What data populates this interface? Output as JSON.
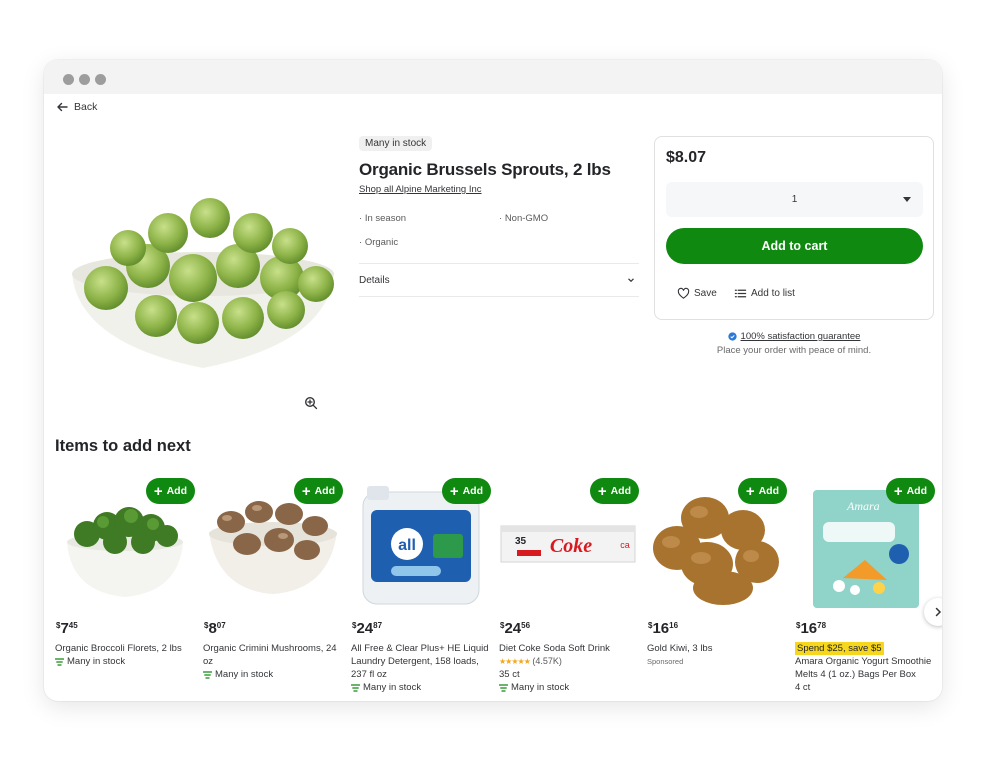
{
  "nav": {
    "back_label": "Back"
  },
  "product": {
    "stock_badge": "Many in stock",
    "title": "Organic Brussels Sprouts, 2 lbs",
    "shop_link": "Shop all Alpine Marketing Inc",
    "attributes": [
      "In season",
      "Non-GMO",
      "Organic"
    ],
    "details_label": "Details"
  },
  "buybox": {
    "price": "$8.07",
    "quantity": "1",
    "add_to_cart": "Add to cart",
    "save_label": "Save",
    "add_to_list_label": "Add to list"
  },
  "guarantee": {
    "title": "100% satisfaction guarantee",
    "subtitle": "Place your order with peace of mind."
  },
  "recommendations": {
    "section_title": "Items to add next",
    "add_label": "Add",
    "items": [
      {
        "price_dollars": "7",
        "price_cents": "45",
        "name": "Organic Broccoli Florets, 2 lbs",
        "stock": "Many in stock"
      },
      {
        "price_dollars": "8",
        "price_cents": "07",
        "name": "Organic Crimini Mushrooms, 24 oz",
        "stock": "Many in stock"
      },
      {
        "price_dollars": "24",
        "price_cents": "87",
        "name": "All Free & Clear Plus+ HE Liquid Laundry Detergent, 158 loads, 237 fl oz",
        "stock": "Many in stock"
      },
      {
        "price_dollars": "24",
        "price_cents": "56",
        "name": "Diet Coke Soda Soft Drink",
        "rating": "(4.57K)",
        "size": "35 ct",
        "stock": "Many in stock"
      },
      {
        "price_dollars": "16",
        "price_cents": "16",
        "name": "Gold Kiwi, 3 lbs",
        "sponsored": "Sponsored"
      },
      {
        "price_dollars": "16",
        "price_cents": "78",
        "promo": "Spend $25, save $5",
        "name": "Amara Organic Yogurt Smoothie Melts 4 (1 oz.) Bags Per Box",
        "size": "4 ct"
      }
    ]
  },
  "colors": {
    "accent_green": "#108910",
    "promo_yellow": "#f7d71d"
  }
}
